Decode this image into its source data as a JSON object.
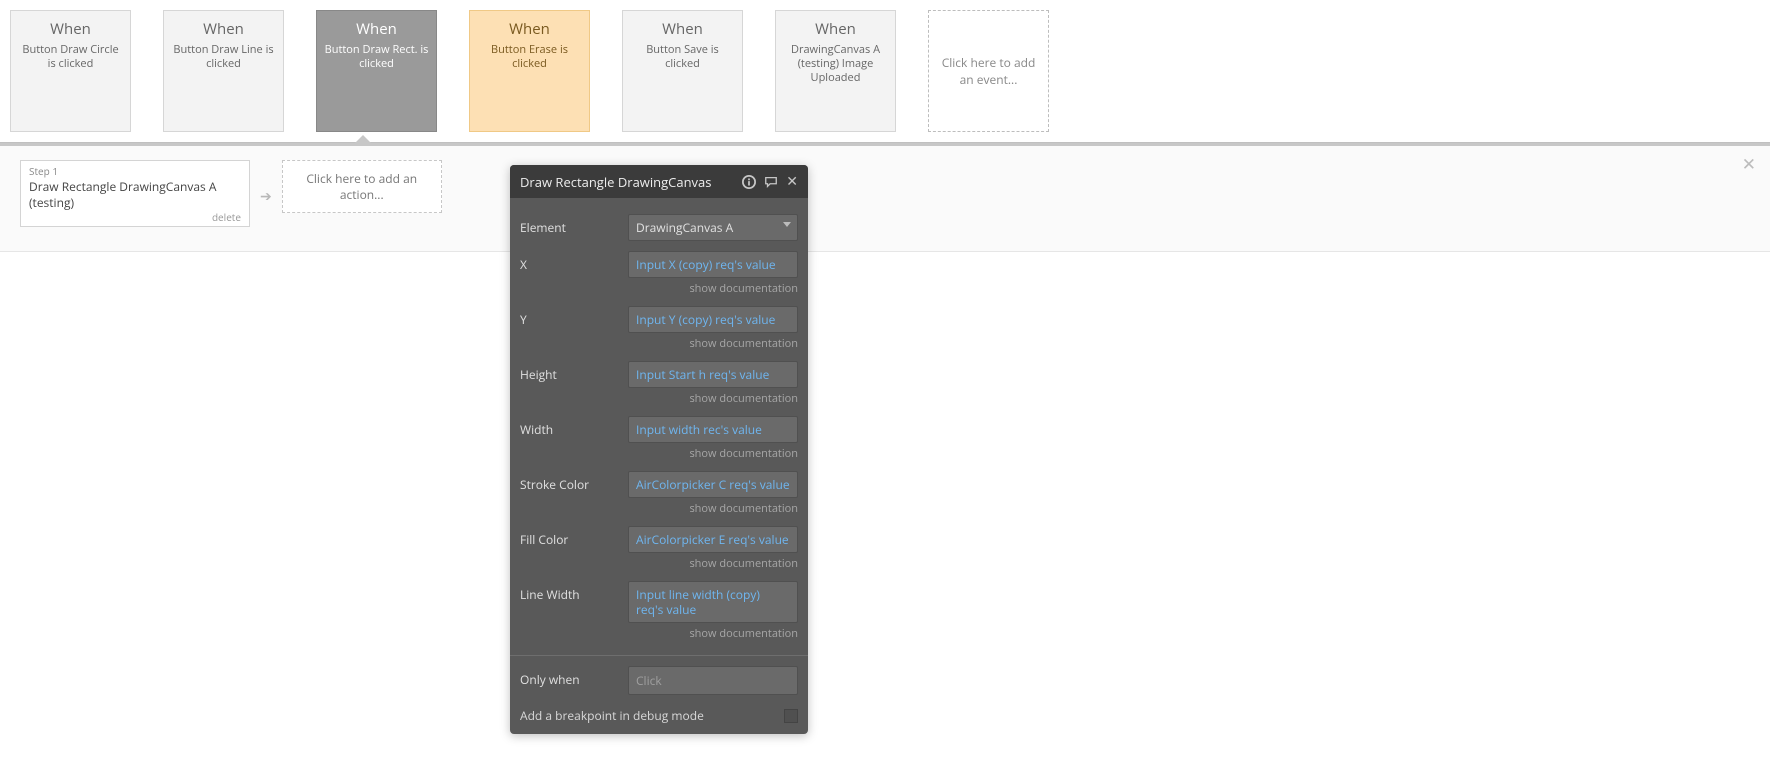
{
  "events": [
    {
      "when": "When",
      "desc": "Button Draw Circle is clicked",
      "state": "normal"
    },
    {
      "when": "When",
      "desc": "Button Draw Line is clicked",
      "state": "normal"
    },
    {
      "when": "When",
      "desc": "Button Draw Rect. is clicked",
      "state": "selected"
    },
    {
      "when": "When",
      "desc": "Button Erase is clicked",
      "state": "warn"
    },
    {
      "when": "When",
      "desc": "Button Save is clicked",
      "state": "normal"
    },
    {
      "when": "When",
      "desc": "DrawingCanvas A (testing) Image Uploaded",
      "state": "normal"
    }
  ],
  "add_event_label": "Click here to add an event...",
  "step": {
    "num_label": "Step 1",
    "title": "Draw Rectangle DrawingCanvas A (testing)",
    "delete_label": "delete"
  },
  "add_action_label": "Click here to add an action...",
  "panel": {
    "title": "Draw Rectangle DrawingCanvas",
    "rows": {
      "element": {
        "label": "Element",
        "value": "DrawingCanvas A",
        "doc": false,
        "dropdown": true
      },
      "x": {
        "label": "X",
        "value": "Input X (copy) req's value",
        "doc": true
      },
      "y": {
        "label": "Y",
        "value": "Input Y (copy) req's value",
        "doc": true
      },
      "height": {
        "label": "Height",
        "value": "Input Start h req's value",
        "doc": true
      },
      "width": {
        "label": "Width",
        "value": "Input width rec's value",
        "doc": true
      },
      "stroke_color": {
        "label": "Stroke Color",
        "value": "AirColorpicker C req's value",
        "doc": true
      },
      "fill_color": {
        "label": "Fill Color",
        "value": "AirColorpicker E req's value",
        "doc": true
      },
      "line_width": {
        "label": "Line Width",
        "value": "Input line width (copy) req's value",
        "doc": true
      }
    },
    "show_doc_label": "show documentation",
    "only_when_label": "Only when",
    "only_when_placeholder": "Click",
    "breakpoint_label": "Add a breakpoint in debug mode"
  }
}
